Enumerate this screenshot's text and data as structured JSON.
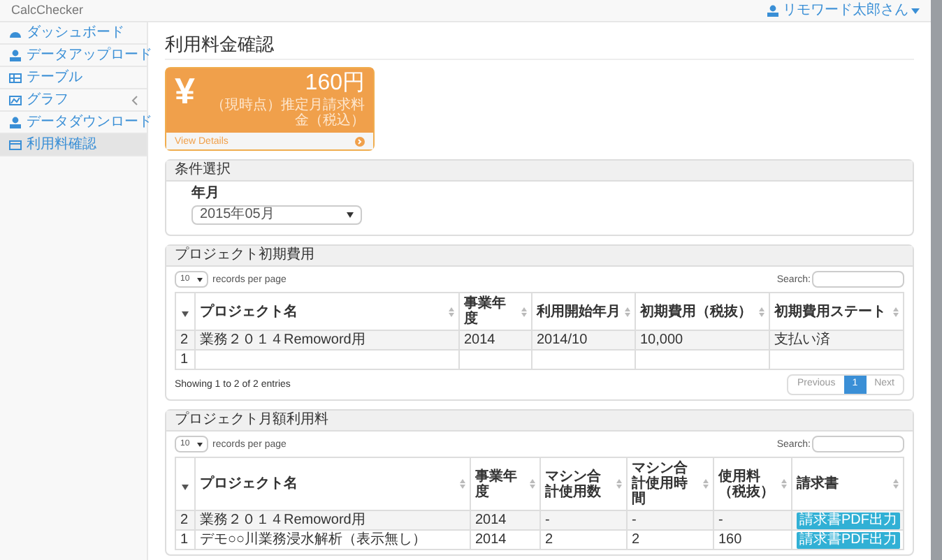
{
  "navbar": {
    "brand": "CalcChecker",
    "user": "リモワード太郎さん"
  },
  "sidebar": {
    "items": [
      {
        "label": "ダッシュボード",
        "selected": false,
        "submenu": false
      },
      {
        "label": "データアップロード",
        "selected": false,
        "submenu": false
      },
      {
        "label": "テーブル",
        "selected": false,
        "submenu": false
      },
      {
        "label": "グラフ",
        "selected": false,
        "submenu": true
      },
      {
        "label": "データダウンロード",
        "selected": false,
        "submenu": false
      },
      {
        "label": "利用料確認",
        "selected": true,
        "submenu": false
      }
    ]
  },
  "page_title": "利用料金確認",
  "summary_card": {
    "symbol": "¥",
    "amount": "160円",
    "caption": "（現時点）推定月請求料金（税込）",
    "link": "View Details"
  },
  "conditions": {
    "title": "条件選択",
    "field_label": "年月",
    "value": "2015年05月"
  },
  "initial_costs": {
    "title": "プロジェクト初期費用",
    "page_size": "10",
    "page_size_label": "records per page",
    "search_label": "Search:",
    "columns": [
      "",
      "プロジェクト名",
      "事業年度",
      "利用開始年月",
      "初期費用（税抜）",
      "初期費用ステート"
    ],
    "rows": [
      {
        "cells": [
          "2",
          "業務２０１４Remoword用",
          "2014",
          "2014/10",
          "10,000",
          "支払い済"
        ]
      },
      {
        "cells": [
          "1"
        ]
      }
    ],
    "info": "Showing 1 to 2 of 2 entries",
    "pagination": [
      {
        "label": "Previous",
        "selected": false
      },
      {
        "label": "1",
        "selected": true
      },
      {
        "label": "Next",
        "selected": false
      }
    ]
  },
  "monthly_costs": {
    "title": "プロジェクト月額利用料",
    "page_size": "10",
    "page_size_label": "records per page",
    "search_label": "Search:",
    "columns": [
      "",
      "プロジェクト名",
      "事業年度",
      "マシン合計使用数",
      "マシン合計使用時間",
      "使用料（税抜）",
      "請求書"
    ],
    "rows": [
      {
        "cells": [
          "2",
          "業務２０１４Remoword用",
          "2014",
          "-",
          "-",
          "-"
        ],
        "button": "請求書PDF出力"
      },
      {
        "cells": [
          "1",
          "デモ○○川業務浸水解析（表示無し）",
          "2014",
          "2",
          "2",
          "160"
        ],
        "button": "請求書PDF出力"
      }
    ]
  }
}
